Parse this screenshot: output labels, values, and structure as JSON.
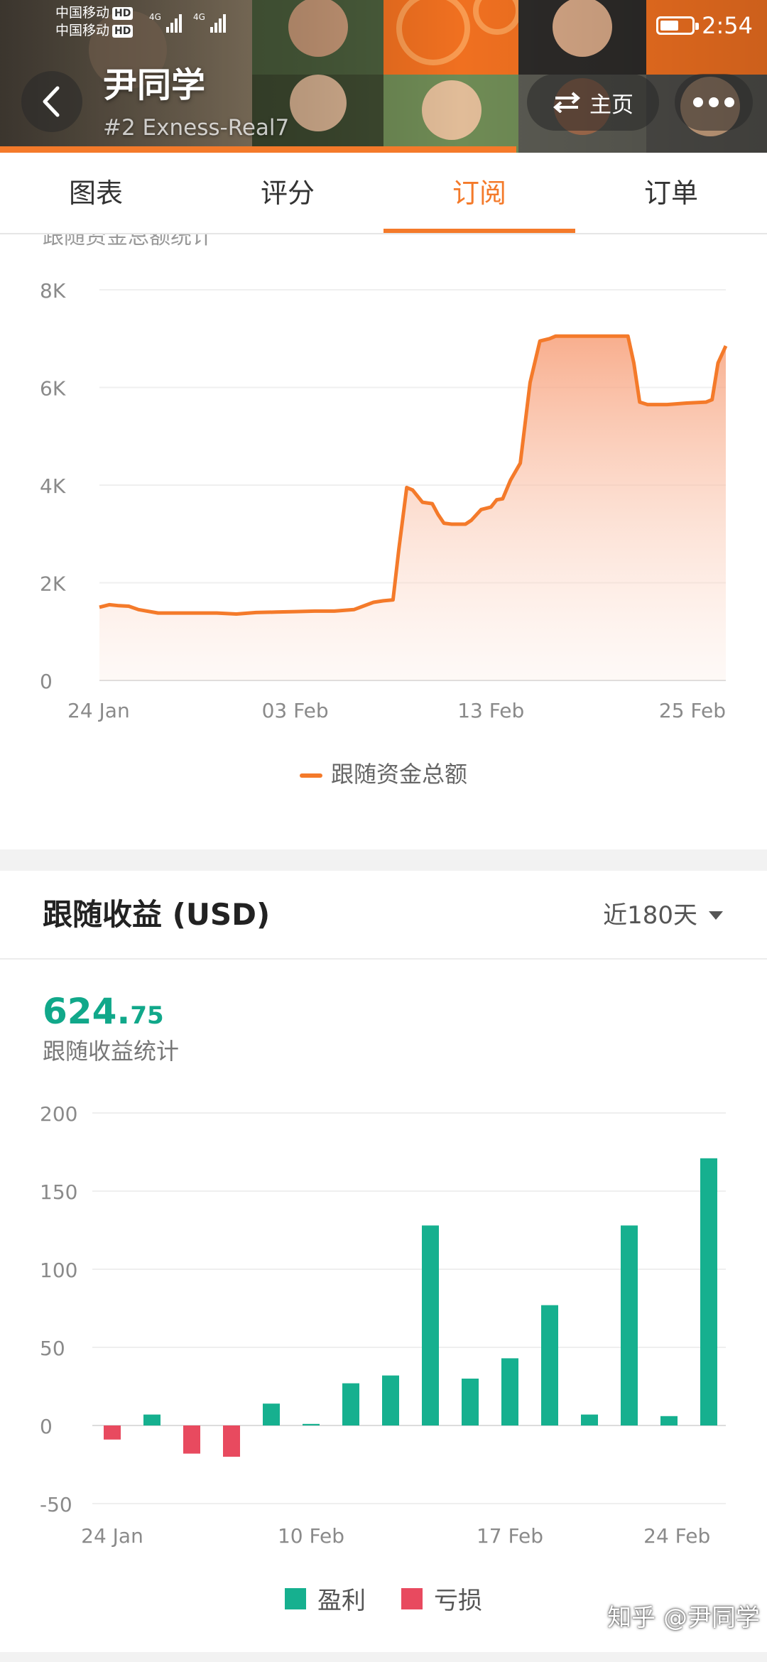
{
  "status_bar": {
    "carrier_1": "中国移动",
    "carrier_2": "中国移动",
    "hd_badge": "HD",
    "network": "4G",
    "time": "2:54",
    "battery_level": 0.6
  },
  "header": {
    "name": "尹同学",
    "subtitle": "#2  Exness-Real7",
    "home_label": "主页",
    "back_icon": "chevron-left-icon",
    "home_icon": "swap-icon",
    "more_icon": "more-dots-icon",
    "accent": "#f47a2a"
  },
  "tabs": [
    {
      "label": "图表",
      "active": false
    },
    {
      "label": "评分",
      "active": false
    },
    {
      "label": "订阅",
      "active": true
    },
    {
      "label": "订单",
      "active": false
    }
  ],
  "follow_fund_chart": {
    "cut_title": "跟随资金总额统计",
    "legend": "跟随资金总额",
    "chart_data": {
      "type": "area",
      "series": [
        {
          "name": "跟随资金总额",
          "color": "#f47a2a"
        }
      ],
      "x": [
        0,
        0.5,
        1,
        1.5,
        2,
        3,
        4,
        5,
        6,
        7,
        8,
        9,
        10,
        11,
        12,
        13,
        14,
        14.5,
        15,
        15.3,
        15.7,
        16,
        16.5,
        17,
        17.3,
        17.6,
        18,
        18.3,
        18.7,
        19,
        19.5,
        20,
        20.3,
        20.6,
        21,
        21.5,
        22,
        22.5,
        23,
        23.3,
        23.6,
        24,
        25,
        26,
        27,
        27.3,
        27.6,
        28,
        29,
        30,
        31,
        31.3,
        31.6,
        32
      ],
      "values": [
        1500,
        1550,
        1530,
        1520,
        1450,
        1380,
        1380,
        1380,
        1380,
        1360,
        1390,
        1400,
        1410,
        1420,
        1420,
        1450,
        1600,
        1630,
        1650,
        2700,
        3950,
        3900,
        3650,
        3620,
        3400,
        3220,
        3200,
        3200,
        3200,
        3280,
        3500,
        3550,
        3700,
        3720,
        4100,
        4450,
        6100,
        6950,
        7000,
        7050,
        7050,
        7050,
        7050,
        7050,
        7050,
        6500,
        5700,
        5650,
        5650,
        5680,
        5700,
        5750,
        6500,
        6850
      ],
      "x_ticks": [
        "24 Jan",
        "03 Feb",
        "13 Feb",
        "25 Feb"
      ],
      "x_tick_positions": [
        0,
        10,
        20,
        32
      ],
      "y_ticks": [
        "0",
        "2K",
        "4K",
        "6K",
        "8K"
      ],
      "ylim": [
        0,
        8000
      ],
      "grid": true
    }
  },
  "follow_profit": {
    "title": "跟随收益 (USD)",
    "period": "近180天",
    "total_int": "624.",
    "total_dec": "75",
    "total_label": "跟随收益统计",
    "legend_profit": "盈利",
    "legend_loss": "亏损",
    "profit_color": "#16b08f",
    "loss_color": "#e84a5f",
    "chart_data": {
      "type": "bar",
      "values": [
        -9,
        7,
        -18,
        -20,
        14,
        1,
        27,
        32,
        128,
        30,
        43,
        77,
        7,
        128,
        6,
        171
      ],
      "x_ticks": [
        "24 Jan",
        "10 Feb",
        "17 Feb",
        "24 Feb"
      ],
      "x_tick_bars": [
        0,
        5,
        10,
        14.2
      ],
      "y_ticks": [
        "-50",
        "0",
        "50",
        "100",
        "150",
        "200"
      ],
      "ylim": [
        -50,
        200
      ],
      "grid": true
    }
  },
  "watermark": "知乎 @尹同学"
}
